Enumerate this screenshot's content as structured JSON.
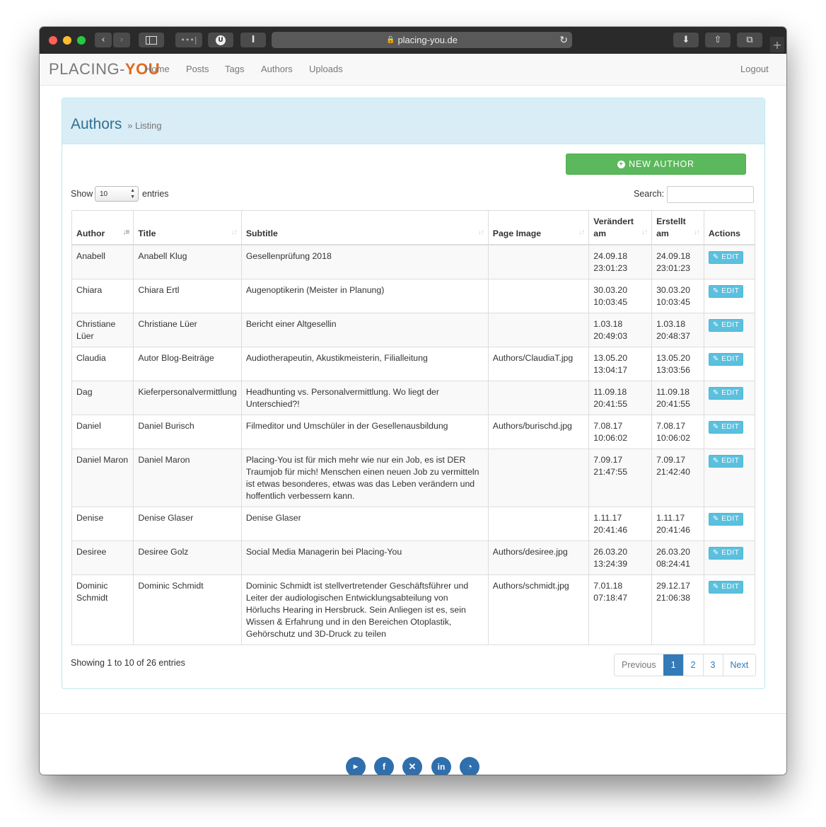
{
  "browser": {
    "url": "placing-you.de"
  },
  "nav": {
    "logo_a": "PLACING-",
    "logo_b": "YOU",
    "items": [
      "Home",
      "Posts",
      "Tags",
      "Authors",
      "Uploads"
    ],
    "logout": "Logout"
  },
  "page": {
    "title": "Authors",
    "subtitle": "» Listing",
    "new_button": "NEW AUTHOR",
    "show_label": "Show",
    "show_value": "10",
    "entries_label": "entries",
    "search_label": "Search:",
    "search_value": ""
  },
  "table": {
    "headers": [
      "Author",
      "Title",
      "Subtitle",
      "Page Image",
      "Verändert am",
      "Erstellt am",
      "Actions"
    ],
    "edit_label": "EDIT",
    "rows": [
      {
        "author": "Anabell",
        "title": "Anabell Klug",
        "subtitle": "Gesellenprüfung 2018",
        "image": "",
        "changed_date": "24.09.18",
        "changed_time": "23:01:23",
        "created_date": "24.09.18",
        "created_time": "23:01:23"
      },
      {
        "author": "Chiara",
        "title": "Chiara Ertl",
        "subtitle": "Augenoptikerin (Meister in Planung)",
        "image": "",
        "changed_date": "30.03.20",
        "changed_time": "10:03:45",
        "created_date": "30.03.20",
        "created_time": "10:03:45"
      },
      {
        "author": "Christiane Lüer",
        "title": "Christiane Lüer",
        "subtitle": "Bericht einer Altgesellin",
        "image": "",
        "changed_date": "1.03.18",
        "changed_time": "20:49:03",
        "created_date": "1.03.18",
        "created_time": "20:48:37"
      },
      {
        "author": "Claudia",
        "title": "Autor Blog-Beiträge",
        "subtitle": "Audiotherapeutin, Akustikmeisterin, Filialleitung",
        "image": "Authors/ClaudiaT.jpg",
        "changed_date": "13.05.20",
        "changed_time": "13:04:17",
        "created_date": "13.05.20",
        "created_time": "13:03:56"
      },
      {
        "author": "Dag",
        "title": "Kieferpersonalvermittlung",
        "subtitle": "Headhunting vs. Personalvermittlung. Wo liegt der Unterschied?!",
        "image": "",
        "changed_date": "11.09.18",
        "changed_time": "20:41:55",
        "created_date": "11.09.18",
        "created_time": "20:41:55"
      },
      {
        "author": "Daniel",
        "title": "Daniel Burisch",
        "subtitle": "Filmeditor und Umschüler in der Gesellenausbildung",
        "image": "Authors/burischd.jpg",
        "changed_date": "7.08.17",
        "changed_time": "10:06:02",
        "created_date": "7.08.17",
        "created_time": "10:06:02"
      },
      {
        "author": "Daniel Maron",
        "title": "Daniel Maron",
        "subtitle": "Placing-You ist für mich mehr wie nur ein Job, es ist DER Traumjob für mich! Menschen einen neuen Job zu vermitteln ist etwas besonderes, etwas was das Leben verändern und hoffentlich verbessern kann.",
        "image": "",
        "changed_date": "7.09.17",
        "changed_time": "21:47:55",
        "created_date": "7.09.17",
        "created_time": "21:42:40"
      },
      {
        "author": "Denise",
        "title": "Denise Glaser",
        "subtitle": "Denise Glaser",
        "image": "",
        "changed_date": "1.11.17",
        "changed_time": "20:41:46",
        "created_date": "1.11.17",
        "created_time": "20:41:46"
      },
      {
        "author": "Desiree",
        "title": "Desiree Golz",
        "subtitle": "Social Media Managerin bei Placing-You",
        "image": "Authors/desiree.jpg",
        "changed_date": "26.03.20",
        "changed_time": "13:24:39",
        "created_date": "26.03.20",
        "created_time": "08:24:41"
      },
      {
        "author": "Dominic Schmidt",
        "title": "Dominic Schmidt",
        "subtitle": "Dominic Schmidt ist stellvertretender Geschäftsführer und Leiter der audiologischen Entwicklungsabteilung von Hörluchs Hearing in Hersbruck. Sein Anliegen ist es, sein Wissen & Erfahrung und in den Bereichen Otoplastik, Gehörschutz und 3D-Druck zu teilen",
        "image": "Authors/schmidt.jpg",
        "changed_date": "7.01.18",
        "changed_time": "07:18:47",
        "created_date": "29.12.17",
        "created_time": "21:06:38"
      }
    ]
  },
  "footer_info": "Showing 1 to 10 of 26 entries",
  "pagination": {
    "previous": "Previous",
    "pages": [
      "1",
      "2",
      "3"
    ],
    "active": "1",
    "next": "Next"
  },
  "social": [
    "youtube-icon",
    "facebook-icon",
    "xing-icon",
    "linkedin-icon",
    "rss-icon"
  ],
  "colors": {
    "accent": "#337ab7",
    "success": "#5cb85c",
    "info": "#5bc0de",
    "logo_orange": "#e06a1f",
    "panel_heading": "#d9edf7"
  }
}
